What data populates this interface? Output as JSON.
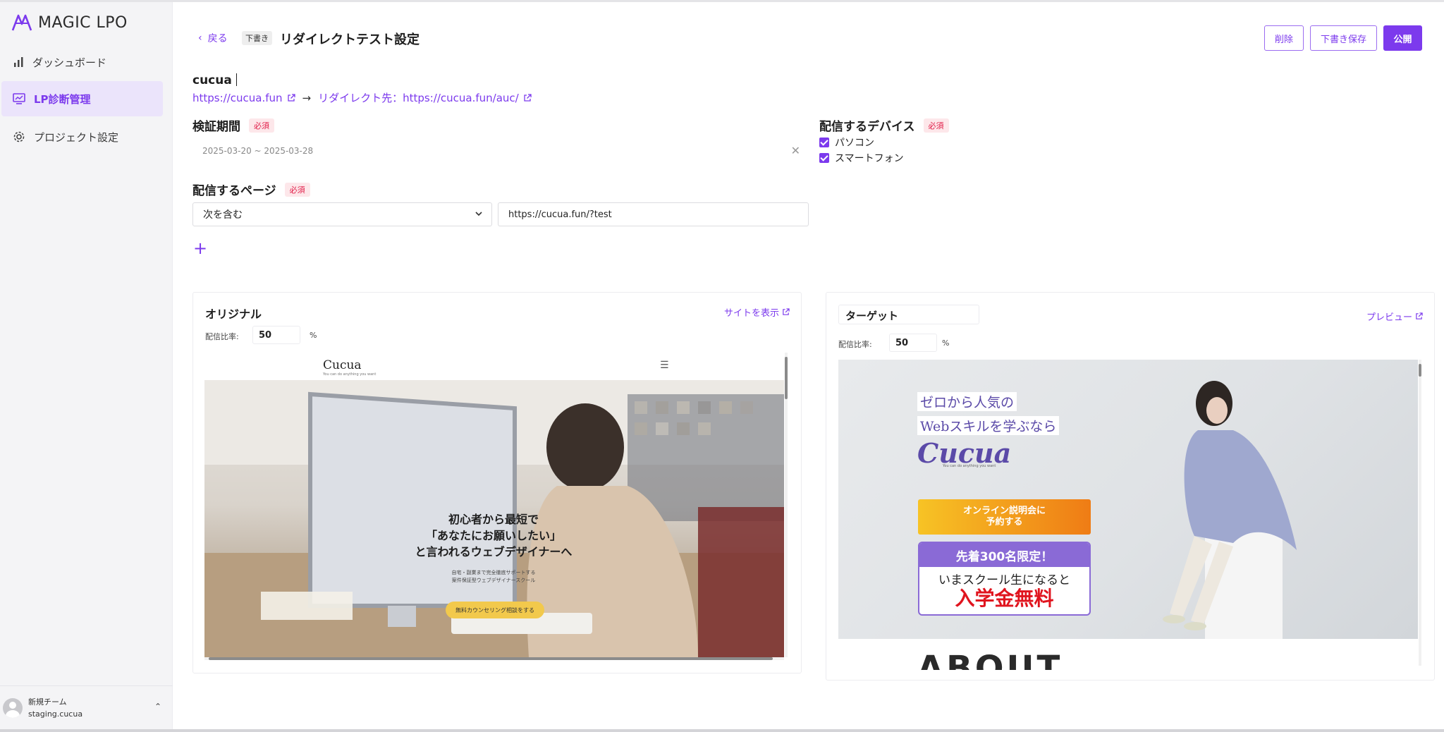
{
  "app": {
    "name": "MAGIC LPO"
  },
  "sidebar": {
    "items": [
      {
        "label": "ダッシュボード",
        "icon": "bar-chart-icon"
      },
      {
        "label": "LP診断管理",
        "icon": "monitor-chart-icon",
        "active": true
      },
      {
        "label": "プロジェクト設定",
        "icon": "gear-icon"
      }
    ],
    "team": {
      "name": "新規チーム",
      "sub": "staging.cucua"
    }
  },
  "header": {
    "back": "戻る",
    "status_badge": "下書き",
    "title": "リダイレクトテスト設定",
    "buttons": {
      "delete": "削除",
      "save_draft": "下書き保存",
      "publish": "公開"
    }
  },
  "project": {
    "name": "cucua",
    "original_url": "https://cucua.fun",
    "redirect_text": "リダイレクト先：https://cucua.fun/auc/"
  },
  "form": {
    "period": {
      "label": "検証期間",
      "required": "必須",
      "value": "2025-03-20 ~ 2025-03-28"
    },
    "devices": {
      "label": "配信するデバイス",
      "required": "必須",
      "options": [
        {
          "label": "パソコン",
          "checked": true
        },
        {
          "label": "スマートフォン",
          "checked": true
        }
      ]
    },
    "pages": {
      "label": "配信するページ",
      "required": "必須",
      "condition": "次を含む",
      "url": "https://cucua.fun/?test"
    }
  },
  "original_panel": {
    "title": "オリジナル",
    "link": "サイトを表示",
    "ratio_label": "配信比率:",
    "ratio": "50",
    "unit": "%",
    "preview": {
      "logo": "Cucua",
      "tagline": "You can do anything you want",
      "headline": [
        "初心者から最短で",
        "「あなたにお願いしたい」",
        "と言われるウェブデザイナーへ"
      ],
      "sub": [
        "自宅・副業まで完全徹底サポートする",
        "案件保証型ウェブデザイナースクール"
      ],
      "cta": "無料カウンセリング相談をする"
    }
  },
  "target_panel": {
    "title": "ターゲット",
    "link": "プレビュー",
    "ratio_label": "配信比率:",
    "ratio": "50",
    "unit": "%",
    "preview": {
      "line1": "ゼロから人気の",
      "line2": "Webスキルを学ぶなら",
      "logo": "Cucua",
      "tagline": "You can do anything you want",
      "cta": [
        "オンライン説明会に",
        "予約する"
      ],
      "offer_head": "先着300名限定！",
      "offer_line": "いまスクール生になると",
      "offer_big": "入学金無料",
      "about": "ABOUT"
    }
  },
  "colors": {
    "accent": "#7c3aed",
    "required_bg": "#fde7ea",
    "required_text": "#e11d48"
  }
}
